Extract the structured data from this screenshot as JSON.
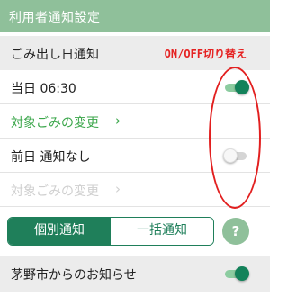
{
  "header": {
    "title": "利用者通知設定"
  },
  "section": {
    "title": "ごみ出し日通知",
    "hint": "ON/OFF切り替え"
  },
  "rows": [
    {
      "label": "当日 06:30",
      "toggle": "on"
    },
    {
      "label": "対象ごみの変更",
      "chevron": "›",
      "enabled": true
    },
    {
      "label": "前日 通知なし",
      "toggle": "off"
    },
    {
      "label": "対象ごみの変更",
      "chevron": "›",
      "enabled": false
    }
  ],
  "segment": {
    "options": [
      "個別通知",
      "一括通知"
    ],
    "selected": "個別通知"
  },
  "help": {
    "label": "?"
  },
  "footer": {
    "label": "茅野市からのお知らせ",
    "toggle": "on"
  },
  "colors": {
    "accent": "#1f7f5a",
    "header": "#8fc09a",
    "link": "#3aa64a",
    "annotation": "#e21f1f"
  }
}
